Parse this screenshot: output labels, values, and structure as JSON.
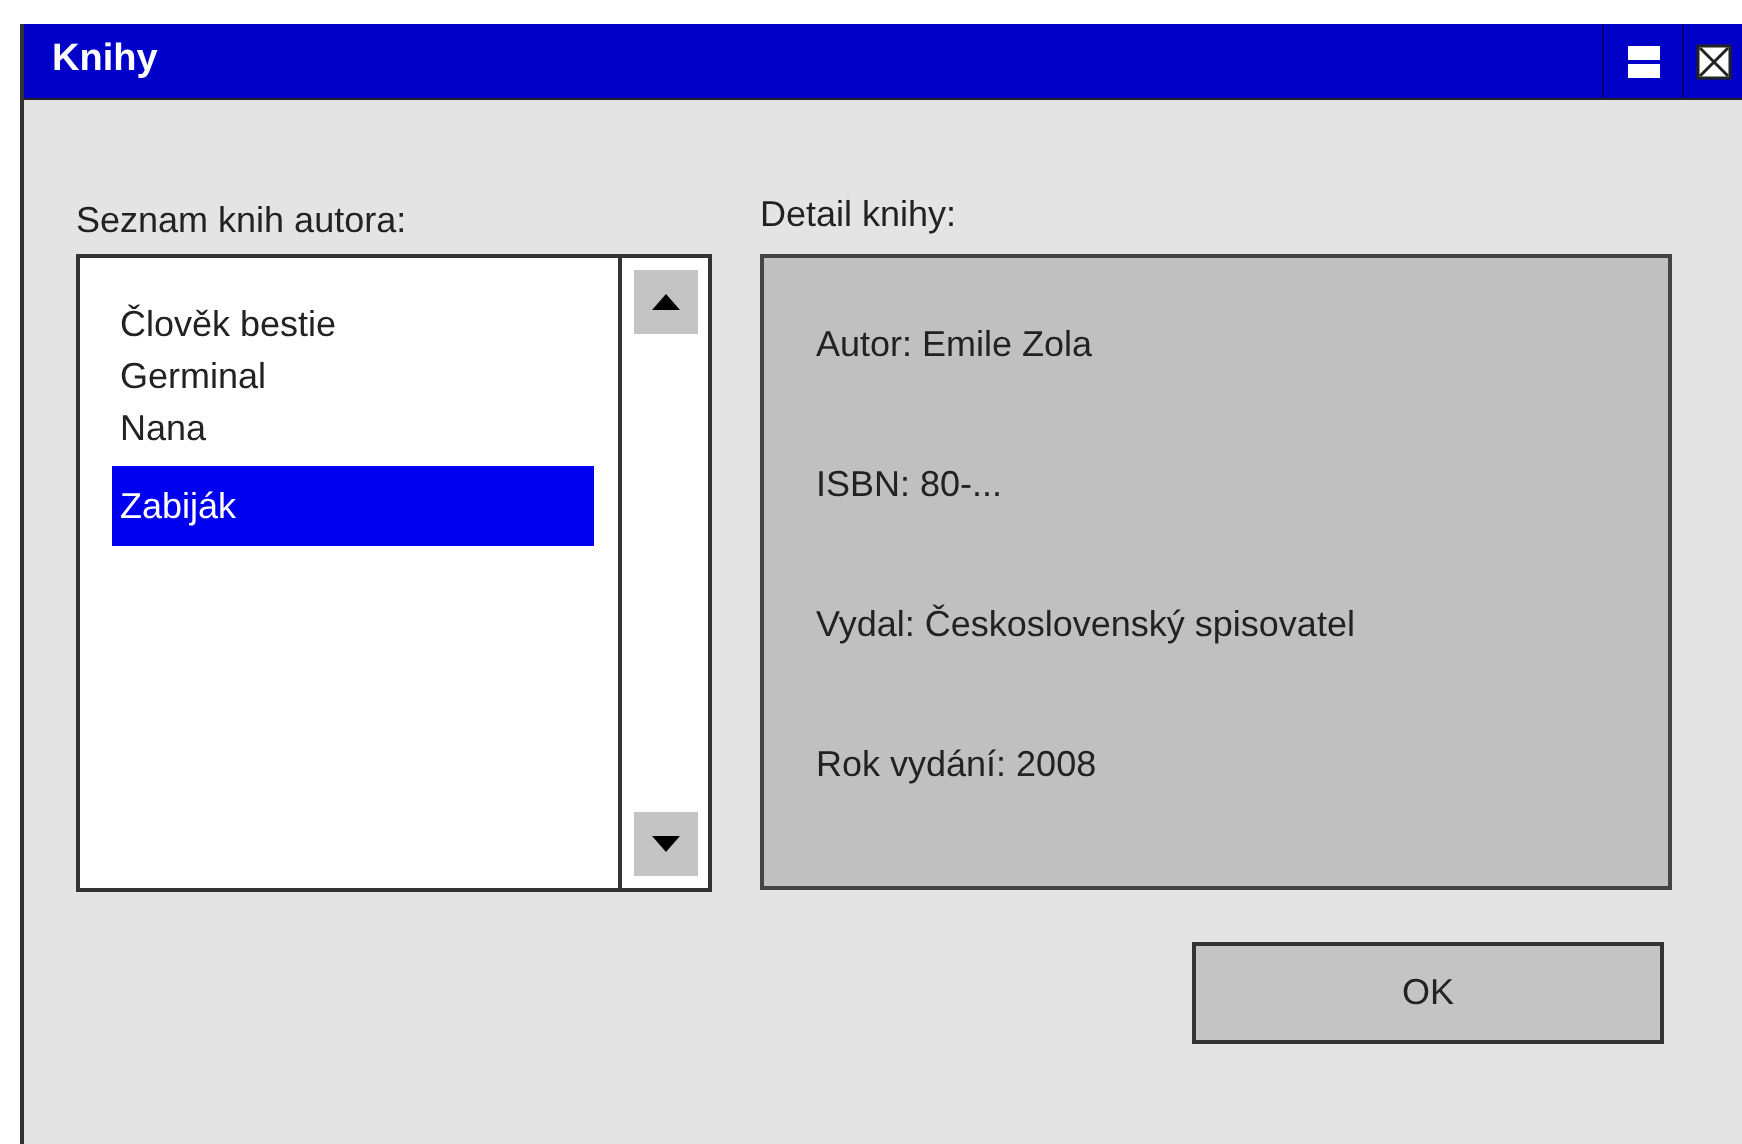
{
  "window": {
    "title": "Knihy"
  },
  "book_list": {
    "label": "Seznam knih autora:",
    "items": [
      {
        "title": "Člověk bestie",
        "selected": false
      },
      {
        "title": "Germinal",
        "selected": false
      },
      {
        "title": "Nana",
        "selected": false
      },
      {
        "title": "Zabiják",
        "selected": true
      }
    ]
  },
  "detail": {
    "label": "Detail knihy:",
    "lines": [
      "Autor: Emile Zola",
      "ISBN: 80-...",
      "Vydal: Československý spisovatel",
      "Rok vydání: 2008"
    ]
  },
  "buttons": [
    "OK"
  ]
}
